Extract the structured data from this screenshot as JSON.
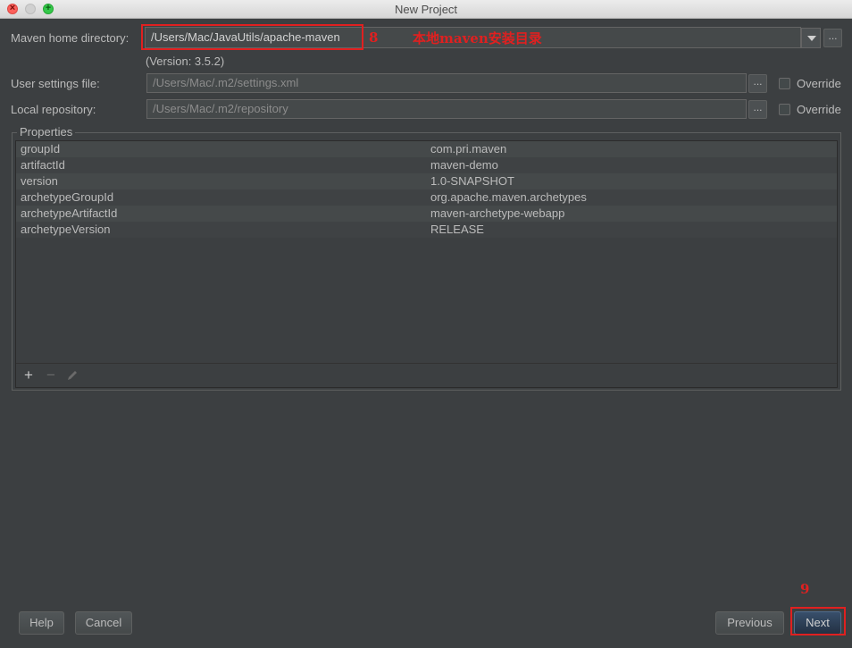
{
  "window": {
    "title": "New Project"
  },
  "maven_home": {
    "label": "Maven home directory:",
    "value": "/Users/Mac/JavaUtils/apache-maven",
    "version": "(Version: 3.5.2)",
    "browse_label": "..."
  },
  "user_settings": {
    "label": "User settings file:",
    "value": "/Users/Mac/.m2/settings.xml",
    "browse_label": "...",
    "override_label": "Override",
    "override_checked": false
  },
  "local_repository": {
    "label": "Local repository:",
    "value": "/Users/Mac/.m2/repository",
    "browse_label": "...",
    "override_label": "Override",
    "override_checked": false
  },
  "annotations": {
    "step_8": "8",
    "note_8": "本地maven安装目录",
    "step_9": "9"
  },
  "properties": {
    "title": "Properties",
    "rows": [
      {
        "key": "groupId",
        "value": "com.pri.maven"
      },
      {
        "key": "artifactId",
        "value": "maven-demo"
      },
      {
        "key": "version",
        "value": "1.0-SNAPSHOT"
      },
      {
        "key": "archetypeGroupId",
        "value": "org.apache.maven.archetypes"
      },
      {
        "key": "archetypeArtifactId",
        "value": "maven-archetype-webapp"
      },
      {
        "key": "archetypeVersion",
        "value": "RELEASE"
      }
    ],
    "toolbar": {
      "add_icon": "plus-icon",
      "remove_icon": "minus-icon",
      "edit_icon": "pencil-icon"
    }
  },
  "buttons": {
    "help": "Help",
    "cancel": "Cancel",
    "previous": "Previous",
    "next": "Next"
  },
  "colors": {
    "background": "#3c3f41",
    "annotation_red": "#e02020",
    "default_button": "#2f4561"
  }
}
